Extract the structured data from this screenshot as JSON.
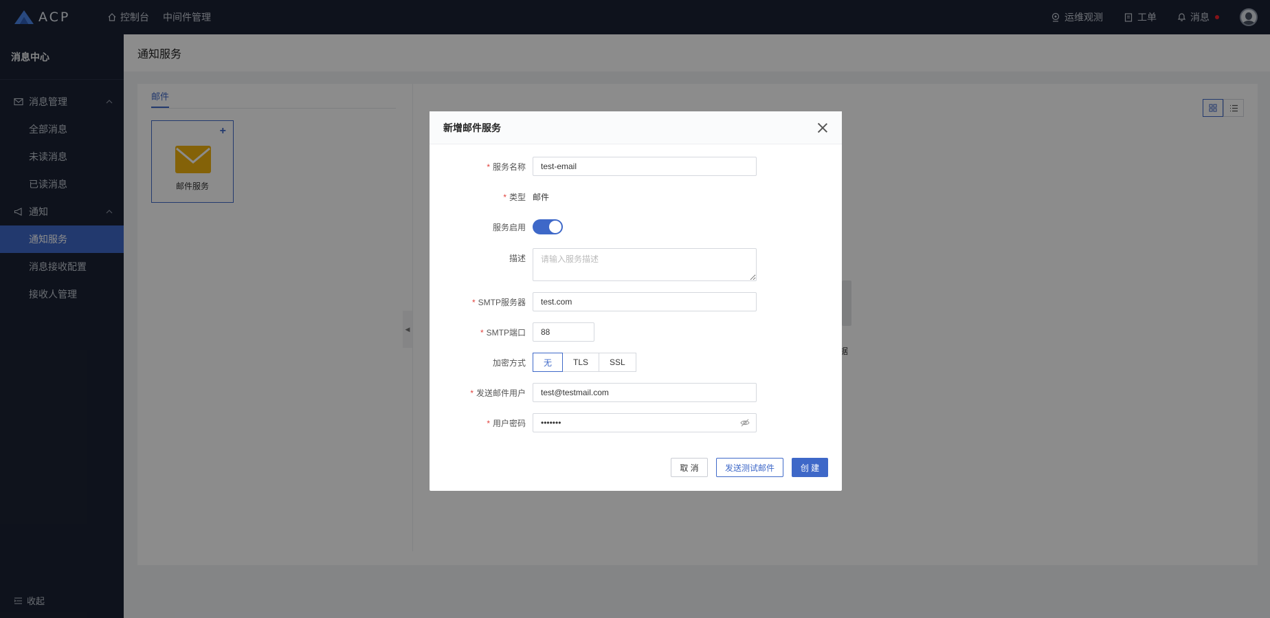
{
  "app": {
    "logo_text": "ACP"
  },
  "topnav": [
    {
      "label": "控制台",
      "icon": "home-icon"
    },
    {
      "label": "中间件管理"
    }
  ],
  "topright": {
    "ops": "运维观测",
    "ticket": "工单",
    "messages": "消息"
  },
  "sidebar": {
    "title": "消息中心",
    "groups": [
      {
        "label": "消息管理",
        "icon": "mail-icon",
        "items": [
          "全部消息",
          "未读消息",
          "已读消息"
        ]
      },
      {
        "label": "通知",
        "icon": "megaphone-icon",
        "items": [
          "通知服务",
          "消息接收配置",
          "接收人管理"
        ]
      }
    ],
    "active_item": "通知服务",
    "collapse": "收起"
  },
  "page": {
    "title": "通知服务",
    "tab": "邮件",
    "card_label": "邮件服务",
    "bg_card_text": "据"
  },
  "modal": {
    "title": "新增邮件服务",
    "fields": {
      "name": {
        "label": "服务名称",
        "value": "test-email"
      },
      "type": {
        "label": "类型",
        "value": "邮件"
      },
      "enabled": {
        "label": "服务启用",
        "value": true
      },
      "desc": {
        "label": "描述",
        "placeholder": "请输入服务描述"
      },
      "smtp_server": {
        "label": "SMTP服务器",
        "value": "test.com"
      },
      "smtp_port": {
        "label": "SMTP端口",
        "value": "88"
      },
      "encryption": {
        "label": "加密方式",
        "options": [
          "无",
          "TLS",
          "SSL"
        ],
        "selected": "无"
      },
      "sender": {
        "label": "发送邮件用户",
        "value": "test@testmail.com"
      },
      "password": {
        "label": "用户密码",
        "value": "•••••••"
      }
    },
    "buttons": {
      "cancel": "取 消",
      "test": "发送测试邮件",
      "create": "创 建"
    }
  },
  "colors": {
    "primary": "#3e68c8",
    "nav_bg": "#1b2233",
    "required": "#e0413c",
    "envelope": "#f0b310"
  }
}
